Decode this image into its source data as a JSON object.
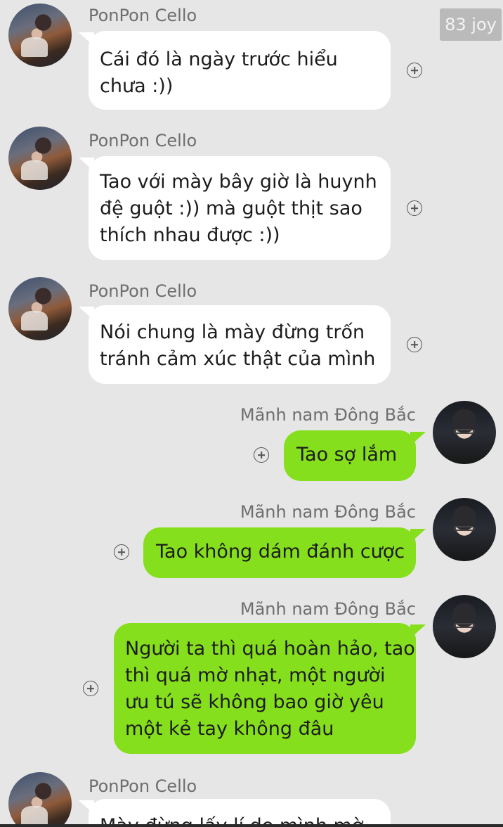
{
  "watermark": "83 joy",
  "messages": [
    {
      "sender": "PonPon Cello",
      "lines": [
        "Cái đó là ngày trước hiểu",
        "chưa :))"
      ]
    },
    {
      "sender": "PonPon Cello",
      "lines": [
        "Tao với mày bây giờ là huynh",
        "đệ guột :)) mà guột thịt sao",
        "thích nhau được :))"
      ]
    },
    {
      "sender": "PonPon Cello",
      "lines": [
        "Nói chung là mày đừng trốn",
        "tránh cảm xúc thật của mình"
      ]
    },
    {
      "sender": "Mãnh nam Đông Bắc",
      "lines": [
        "Tao sợ lắm"
      ]
    },
    {
      "sender": "Mãnh nam Đông Bắc",
      "lines": [
        "Tao không dám đánh cược"
      ]
    },
    {
      "sender": "Mãnh nam Đông Bắc",
      "lines": [
        "Người ta thì quá hoàn hảo, tao",
        "thì quá mờ nhạt, một người",
        "ưu tú sẽ không bao giờ yêu",
        "một kẻ tay không đâu"
      ]
    },
    {
      "sender": "PonPon Cello",
      "lines": [
        "Mày đừng lấy lí do mình mờ"
      ]
    }
  ],
  "colors": {
    "incoming_bubble": "#ffffff",
    "outgoing_bubble": "#86df1c",
    "background": "#e6e6e6"
  },
  "icons": {
    "reaction": "plus-circle-icon"
  }
}
